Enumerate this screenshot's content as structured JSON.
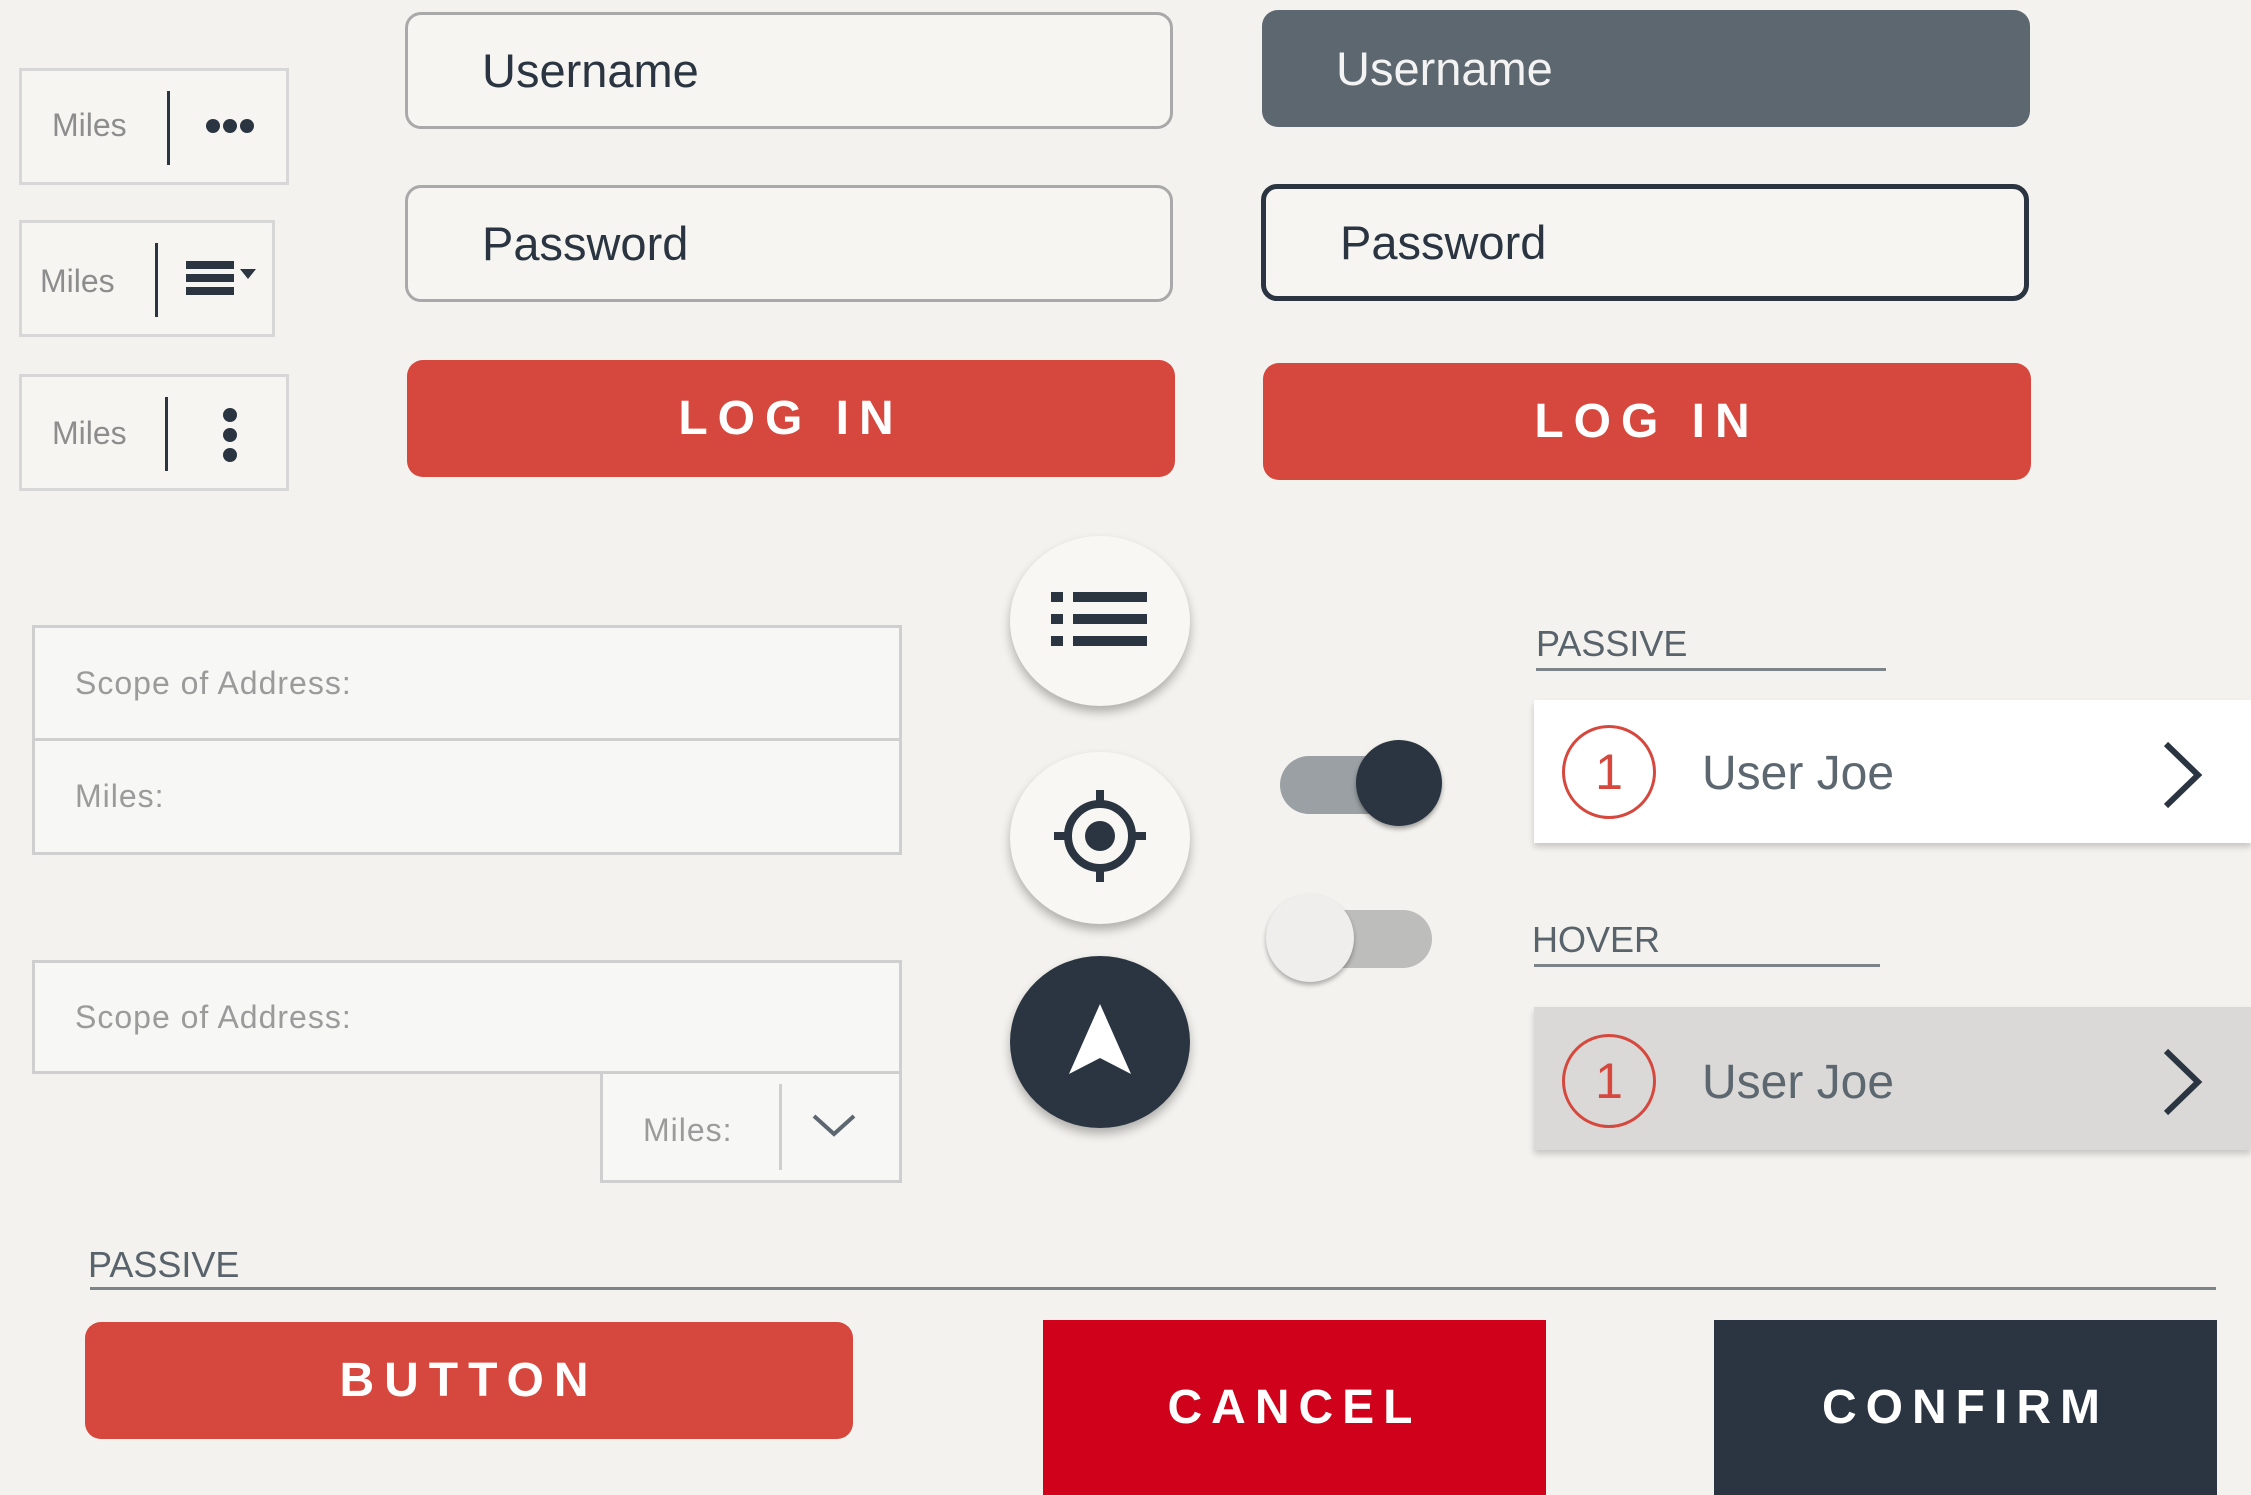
{
  "mini_widgets": [
    {
      "label": "Miles",
      "icon": "more-horizontal-icon"
    },
    {
      "label": "Miles",
      "icon": "list-dropdown-icon"
    },
    {
      "label": "Miles",
      "icon": "more-vertical-icon"
    }
  ],
  "login_passive": {
    "username_placeholder": "Username",
    "password_placeholder": "Password",
    "login_label": "LOG IN"
  },
  "login_active": {
    "username_placeholder": "Username",
    "password_placeholder": "Password",
    "login_label": "LOG IN"
  },
  "address_form_1": {
    "scope_label": "Scope of Address:",
    "miles_label": "Miles:"
  },
  "address_form_2": {
    "scope_label": "Scope of Address:",
    "miles_label": "Miles:",
    "dropdown_icon": "chevron-down-icon"
  },
  "fab_buttons": [
    "list-icon",
    "locate-icon",
    "navigate-arrow-icon"
  ],
  "toggles": [
    {
      "state": "on"
    },
    {
      "state": "off"
    }
  ],
  "user_list": {
    "passive_label": "PASSIVE",
    "hover_label": "HOVER",
    "items": [
      {
        "badge": "1",
        "name": "User Joe"
      },
      {
        "badge": "1",
        "name": "User Joe"
      }
    ]
  },
  "bottom": {
    "section_label": "PASSIVE",
    "button_label": "BUTTON",
    "cancel_label": "CANCEL",
    "confirm_label": "CONFIRM"
  },
  "colors": {
    "accent_red": "#d6483e",
    "cancel_red": "#d0021b",
    "navy": "#2a3541",
    "slate": "#5c676f",
    "background": "#f4f2ee"
  }
}
